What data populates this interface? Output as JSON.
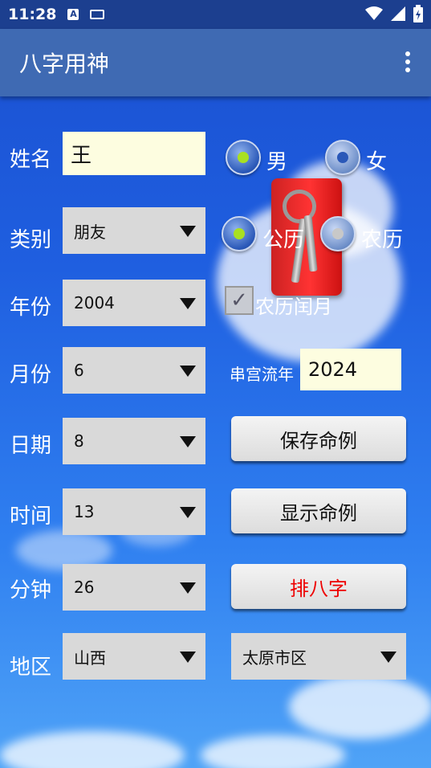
{
  "status_bar": {
    "time": "11:28",
    "icons": [
      "a-notification-icon",
      "keyboard-icon",
      "wifi-icon",
      "signal-icon",
      "battery-icon"
    ]
  },
  "app_bar": {
    "title": "八字用神",
    "menu_icon": "more-vert-icon"
  },
  "form": {
    "name": {
      "label": "姓名",
      "value": "王"
    },
    "gender": {
      "options": [
        "男",
        "女"
      ],
      "selected": "男"
    },
    "category": {
      "label": "类别",
      "value": "朋友"
    },
    "calendar": {
      "options": [
        "公历",
        "农历"
      ],
      "selected": "公历"
    },
    "year": {
      "label": "年份",
      "value": "2004"
    },
    "leap_month": {
      "label": "农历闰月",
      "checked": true
    },
    "month": {
      "label": "月份",
      "value": "6"
    },
    "flow_year": {
      "label": "串宫流年",
      "value": "2024"
    },
    "day": {
      "label": "日期",
      "value": "8"
    },
    "hour": {
      "label": "时间",
      "value": "13"
    },
    "minute": {
      "label": "分钟",
      "value": "26"
    },
    "region": {
      "label": "地区",
      "province": "山西",
      "city": "太原市区"
    }
  },
  "buttons": {
    "save": "保存命例",
    "show": "显示命例",
    "calc": "排八字"
  },
  "colors": {
    "status_bar": "#1c3f8f",
    "app_bar": "#3f6ab3",
    "input_bg": "#fdfde0",
    "spinner_bg": "#d9d9d9",
    "radio_dot": "#a9e021",
    "calc_text": "#ee0000"
  }
}
